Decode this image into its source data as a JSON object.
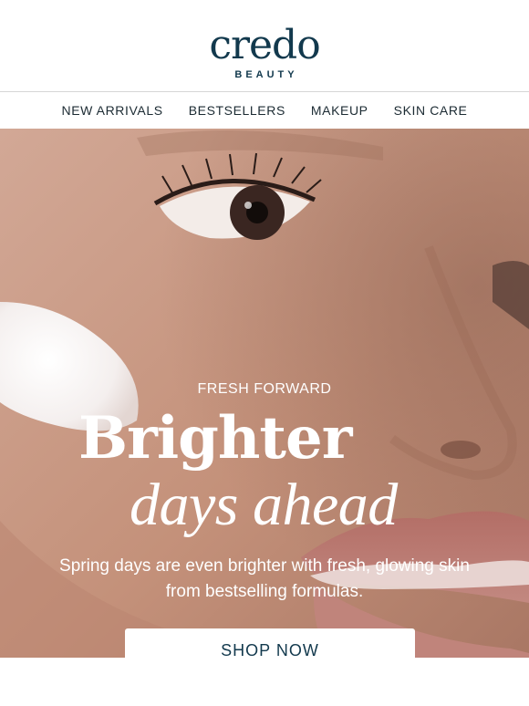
{
  "brand": {
    "logo_main": "credo",
    "logo_sub": "BEAUTY",
    "color": "#12394d"
  },
  "nav": {
    "items": [
      {
        "label": "NEW ARRIVALS"
      },
      {
        "label": "BESTSELLERS"
      },
      {
        "label": "MAKEUP"
      },
      {
        "label": "SKIN CARE"
      }
    ]
  },
  "hero": {
    "eyebrow": "FRESH FORWARD",
    "headline_line1": "Brighter",
    "headline_line2": "days ahead",
    "subcopy": "Spring days are even brighter with fresh, glowing skin from bestselling formulas.",
    "cta_label": "SHOP NOW",
    "skin_color": "#c99a84",
    "lip_color": "#b97870",
    "text_color": "#ffffff"
  }
}
